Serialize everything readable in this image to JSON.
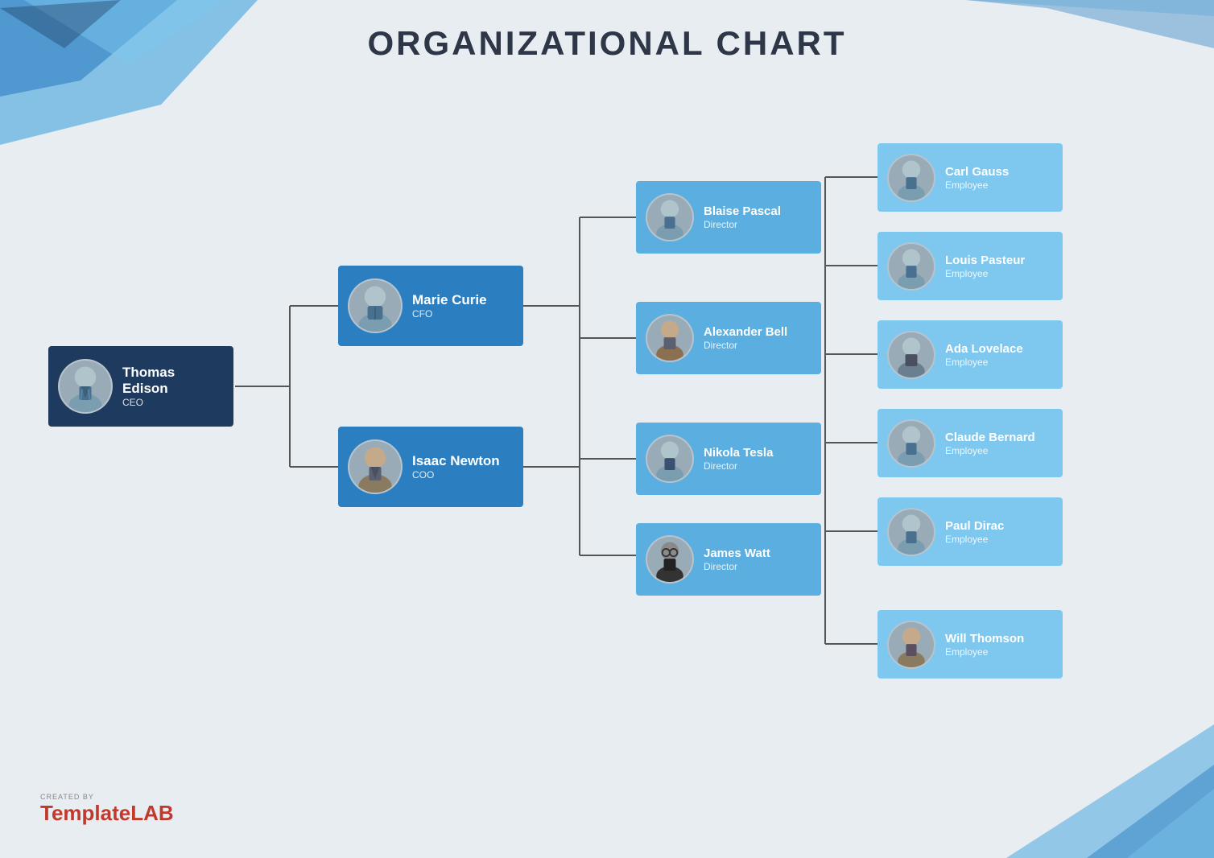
{
  "title": "ORGANIZATIONAL CHART",
  "logo": {
    "created_by": "CREATED BY",
    "brand_light": "Template",
    "brand_bold": "LAB"
  },
  "nodes": {
    "ceo": {
      "name": "Thomas Edison",
      "role": "CEO"
    },
    "vp1": {
      "name": "Marie Curie",
      "role": "CFO"
    },
    "vp2": {
      "name": "Isaac Newton",
      "role": "COO"
    },
    "dir1": {
      "name": "Blaise Pascal",
      "role": "Director"
    },
    "dir2": {
      "name": "Alexander Bell",
      "role": "Director"
    },
    "dir3": {
      "name": "Nikola Tesla",
      "role": "Director"
    },
    "dir4": {
      "name": "James Watt",
      "role": "Director"
    },
    "emp1": {
      "name": "Carl Gauss",
      "role": "Employee"
    },
    "emp2": {
      "name": "Louis Pasteur",
      "role": "Employee"
    },
    "emp3": {
      "name": "Ada Lovelace",
      "role": "Employee"
    },
    "emp4": {
      "name": "Claude Bernard",
      "role": "Employee"
    },
    "emp5": {
      "name": "Paul Dirac",
      "role": "Employee"
    },
    "emp6": {
      "name": "Will Thomson",
      "role": "Employee"
    }
  }
}
